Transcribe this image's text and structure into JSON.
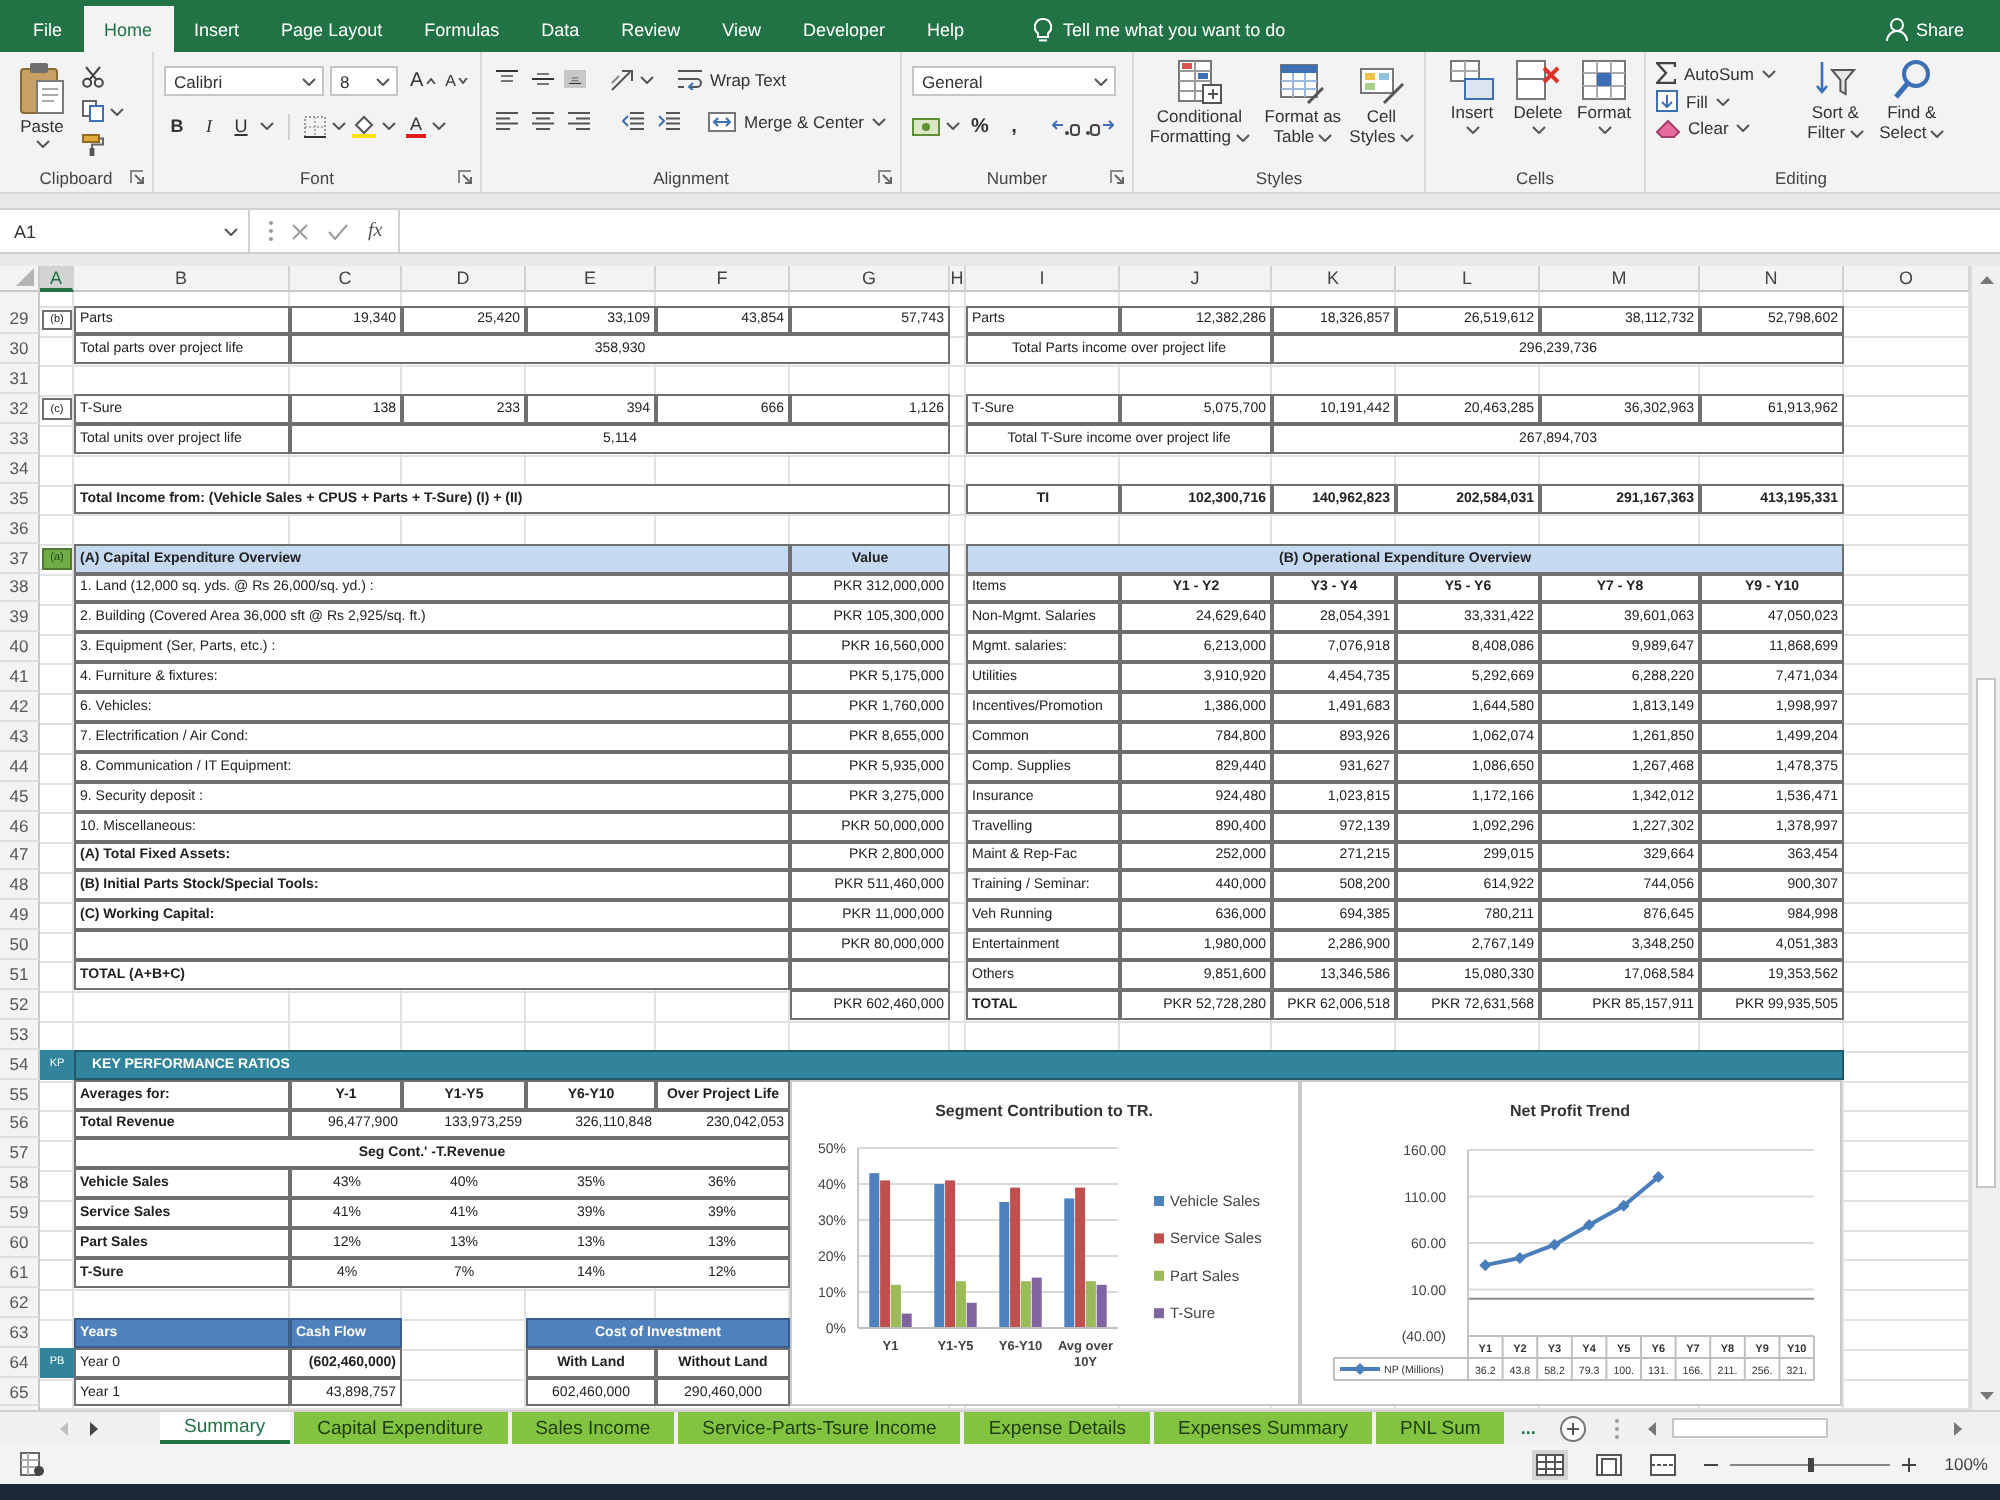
{
  "menu_tabs": [
    {
      "label": "File",
      "selected": false
    },
    {
      "label": "Home",
      "selected": true
    },
    {
      "label": "Insert",
      "selected": false
    },
    {
      "label": "Page Layout",
      "selected": false
    },
    {
      "label": "Formulas",
      "selected": false
    },
    {
      "label": "Data",
      "selected": false
    },
    {
      "label": "Review",
      "selected": false
    },
    {
      "label": "View",
      "selected": false
    },
    {
      "label": "Developer",
      "selected": false
    },
    {
      "label": "Help",
      "selected": false
    }
  ],
  "tell_me": "Tell me what you want to do",
  "share": "Share",
  "ribbon": {
    "clipboard": {
      "label": "Clipboard",
      "paste": "Paste"
    },
    "font": {
      "label": "Font",
      "font_name": "Calibri",
      "font_size": "8",
      "grow": "A",
      "shrink": "A",
      "bold": "B",
      "italic": "I",
      "underline": "U",
      "font_color": "A"
    },
    "alignment": {
      "label": "Alignment",
      "vertical_align": [
        {
          "selected": false
        },
        {
          "selected": false
        },
        {
          "selected": true
        }
      ],
      "wrap_text": "Wrap Text",
      "merge": "Merge & Center"
    },
    "number": {
      "label": "Number",
      "format": "General",
      "percent": "%",
      "comma": ","
    },
    "styles": {
      "label": "Styles",
      "buttons": [
        "Conditional Formatting",
        "Format as Table",
        "Cell Styles"
      ]
    },
    "cells": {
      "label": "Cells",
      "buttons": [
        "Insert",
        "Delete",
        "Format"
      ]
    },
    "editing": {
      "label": "Editing",
      "autosum": "AutoSum",
      "fill": "Fill",
      "clear": "Clear",
      "buttons": [
        "Sort & Filter",
        "Find & Select"
      ]
    }
  },
  "formula_bar": {
    "name_box": "A1",
    "function_label": "fx"
  },
  "sheet": {
    "columns": [
      {
        "label": "A",
        "selected": true
      },
      {
        "label": "B",
        "selected": false
      },
      {
        "label": "C",
        "selected": false
      },
      {
        "label": "D",
        "selected": false
      },
      {
        "label": "E",
        "selected": false
      },
      {
        "label": "F",
        "selected": false
      },
      {
        "label": "G",
        "selected": false
      },
      {
        "label": "H",
        "selected": false
      },
      {
        "label": "I",
        "selected": false
      },
      {
        "label": "J",
        "selected": false
      },
      {
        "label": "K",
        "selected": false
      },
      {
        "label": "L",
        "selected": false
      },
      {
        "label": "M",
        "selected": false
      },
      {
        "label": "N",
        "selected": false
      },
      {
        "label": "O",
        "selected": false
      }
    ],
    "rows": [
      {
        "number": "29",
        "kind": "units",
        "tag": "(b)",
        "label": "Parts",
        "values": [
          "19,340",
          "25,420",
          "33,109",
          "43,854",
          "57,743"
        ],
        "income_label": "Parts",
        "income": [
          "12,382,286",
          "18,326,857",
          "26,519,612",
          "38,112,732",
          "52,798,602"
        ]
      },
      {
        "number": "30",
        "kind": "unit_total",
        "label": "Total parts over project life",
        "value": "358,930",
        "income_label": "Total Parts income over project life",
        "income_value": "296,239,736"
      },
      {
        "number": "31",
        "kind": "blank"
      },
      {
        "number": "32",
        "kind": "units",
        "tag": "(c)",
        "label": "T-Sure",
        "values": [
          "138",
          "233",
          "394",
          "666",
          "1,126"
        ],
        "income_label": "T-Sure",
        "income": [
          "5,075,700",
          "10,191,442",
          "20,463,285",
          "36,302,963",
          "61,913,962"
        ]
      },
      {
        "number": "33",
        "kind": "unit_total",
        "label": "Total units over project life",
        "value": "5,114",
        "income_label": "Total T-Sure income over project life",
        "income_value": "267,894,703"
      },
      {
        "number": "34",
        "kind": "blank"
      },
      {
        "number": "35",
        "kind": "income_total",
        "label": "Total Income from: (Vehicle Sales + CPUS + Parts + T-Sure) (I) + (II)",
        "income_label": "TI",
        "income": [
          "102,300,716",
          "140,962,823",
          "202,584,031",
          "291,167,363",
          "413,195,331"
        ]
      },
      {
        "number": "36",
        "kind": "blank"
      },
      {
        "number": "37",
        "kind": "overview_header",
        "tag": "(a)",
        "capex_title": "(A) Capital Expenditure Overview",
        "value_title": "Value",
        "opex_title": "(B) Operational Expenditure Overview"
      },
      {
        "number": "38",
        "kind": "overview_columns",
        "capex_label": "1. Land (12,000 sq. yds. @ Rs 26,000/sq. yd.) :",
        "capex_value": "PKR 312,000,000",
        "opex_label": "Items",
        "opex_values": [
          "Y1 - Y2",
          "Y3 - Y4",
          "Y5 - Y6",
          "Y7 - Y8",
          "Y9 - Y10"
        ]
      },
      {
        "number": "39",
        "kind": "overview_item",
        "capex_label": "2. Building (Covered Area 36,000 sft @ Rs 2,925/sq. ft.)",
        "capex_value": "PKR 105,300,000",
        "opex_label": "Non-Mgmt. Salaries",
        "opex_values": [
          "24,629,640",
          "28,054,391",
          "33,331,422",
          "39,601,063",
          "47,050,023"
        ]
      },
      {
        "number": "40",
        "kind": "overview_item",
        "capex_label": "3. Equipment (Ser, Parts, etc.) :",
        "capex_value": "PKR 16,560,000",
        "opex_label": "Mgmt. salaries:",
        "opex_values": [
          "6,213,000",
          "7,076,918",
          "8,408,086",
          "9,989,647",
          "11,868,699"
        ]
      },
      {
        "number": "41",
        "kind": "overview_item",
        "capex_label": "4. Furniture & fixtures:",
        "capex_value": "PKR 5,175,000",
        "opex_label": "Utilities",
        "opex_values": [
          "3,910,920",
          "4,454,735",
          "5,292,669",
          "6,288,220",
          "7,471,034"
        ]
      },
      {
        "number": "42",
        "kind": "overview_item",
        "capex_label": "6. Vehicles:",
        "capex_value": "PKR 1,760,000",
        "opex_label": "Incentives/Promotion",
        "opex_values": [
          "1,386,000",
          "1,491,683",
          "1,644,580",
          "1,813,149",
          "1,998,997"
        ]
      },
      {
        "number": "43",
        "kind": "overview_item",
        "capex_label": "7. Electrification / Air Cond:",
        "capex_value": "PKR 8,655,000",
        "opex_label": "Common",
        "opex_values": [
          "784,800",
          "893,926",
          "1,062,074",
          "1,261,850",
          "1,499,204"
        ]
      },
      {
        "number": "44",
        "kind": "overview_item",
        "capex_label": "8. Communication / IT Equipment:",
        "capex_value": "PKR 5,935,000",
        "opex_label": "Comp. Supplies",
        "opex_values": [
          "829,440",
          "931,627",
          "1,086,650",
          "1,267,468",
          "1,478,375"
        ]
      },
      {
        "number": "45",
        "kind": "overview_item",
        "capex_label": "9. Security deposit :",
        "capex_value": "PKR 3,275,000",
        "opex_label": "Insurance",
        "opex_values": [
          "924,480",
          "1,023,815",
          "1,172,166",
          "1,342,012",
          "1,536,471"
        ]
      },
      {
        "number": "46",
        "kind": "overview_item",
        "capex_label": "10. Miscellaneous:",
        "capex_value": "PKR 50,000,000",
        "opex_label": "Travelling",
        "opex_values": [
          "890,400",
          "972,139",
          "1,092,296",
          "1,227,302",
          "1,378,997"
        ]
      },
      {
        "number": "47",
        "kind": "overview_bold",
        "capex_label": "(A) Total Fixed Assets:",
        "capex_value": "PKR 2,800,000",
        "opex_label": "Maint & Rep-Fac",
        "opex_values": [
          "252,000",
          "271,215",
          "299,015",
          "329,664",
          "363,454"
        ]
      },
      {
        "number": "48",
        "kind": "overview_bold",
        "capex_label": "(B) Initial Parts Stock/Special Tools:",
        "capex_value": "PKR 511,460,000",
        "opex_label": "Training / Seminar:",
        "opex_values": [
          "440,000",
          "508,200",
          "614,922",
          "744,056",
          "900,307"
        ]
      },
      {
        "number": "49",
        "kind": "overview_bold",
        "capex_label": "(C) Working Capital:",
        "capex_value": "PKR 11,000,000",
        "opex_label": "Veh Running",
        "opex_values": [
          "636,000",
          "694,385",
          "780,211",
          "876,645",
          "984,998"
        ]
      },
      {
        "number": "50",
        "kind": "overview_item",
        "capex_value": "PKR 80,000,000",
        "opex_label": "Entertainment",
        "opex_values": [
          "1,980,000",
          "2,286,900",
          "2,767,149",
          "3,348,250",
          "4,051,383"
        ]
      },
      {
        "number": "51",
        "kind": "overview_bold",
        "capex_label": "TOTAL (A+B+C)",
        "opex_label": "Others",
        "opex_values": [
          "9,851,600",
          "13,346,586",
          "15,080,330",
          "17,068,584",
          "19,353,562"
        ]
      },
      {
        "number": "52",
        "kind": "overview_total",
        "capex_value": "PKR 602,460,000",
        "opex_label": "TOTAL",
        "opex_values": [
          "PKR 52,728,280",
          "PKR 62,006,518",
          "PKR 72,631,568",
          "PKR 85,157,911",
          "PKR 99,935,505"
        ]
      },
      {
        "number": "53",
        "kind": "blank"
      },
      {
        "number": "54",
        "kind": "kpi_header",
        "tag": "KP",
        "label": "KEY PERFORMANCE RATIOS"
      },
      {
        "number": "55",
        "kind": "kpi_columns",
        "label": "Averages for:",
        "values": [
          "Y-1",
          "Y1-Y5",
          "Y6-Y10",
          "Over Project Life"
        ]
      },
      {
        "number": "56",
        "kind": "kpi_values",
        "label": "Total Revenue",
        "values": [
          "96,477,900",
          "133,973,259",
          "326,110,848",
          "230,042,053"
        ]
      },
      {
        "number": "57",
        "kind": "kpi_subheader",
        "label": "Seg Cont.' -T.Revenue"
      },
      {
        "number": "58",
        "kind": "kpi_share",
        "label": "Vehicle Sales",
        "values": [
          "43%",
          "40%",
          "35%",
          "36%"
        ]
      },
      {
        "number": "59",
        "kind": "kpi_share",
        "label": "Service Sales",
        "values": [
          "41%",
          "41%",
          "39%",
          "39%"
        ]
      },
      {
        "number": "60",
        "kind": "kpi_share",
        "label": "Part Sales",
        "values": [
          "12%",
          "13%",
          "13%",
          "13%"
        ]
      },
      {
        "number": "61",
        "kind": "kpi_share",
        "label": "T-Sure",
        "values": [
          "4%",
          "7%",
          "14%",
          "12%"
        ]
      },
      {
        "number": "62",
        "kind": "blank"
      },
      {
        "number": "63",
        "kind": "cash_header",
        "label": "Years",
        "value": "Cash Flow",
        "cost_label": "Cost of Investment"
      },
      {
        "number": "64",
        "kind": "cash_row_bold",
        "tag": "PB",
        "label": "Year 0",
        "value": "(602,460,000)",
        "cost_values": [
          "With Land",
          "Without Land"
        ]
      },
      {
        "number": "65",
        "kind": "cash_row",
        "label": "Year 1",
        "value": "43,898,757",
        "cost_values": [
          "602,460,000",
          "290,460,000"
        ]
      }
    ],
    "charts": [
      {
        "chart_data": {
          "type": "bar",
          "title": "Segment Contribution to TR.",
          "categories": [
            "Y1",
            "Y1-Y5",
            "Y6-Y10",
            "Avg over 10Y"
          ],
          "series": [
            {
              "name": "Vehicle Sales",
              "color": "#4f81bd",
              "values": [
                43,
                40,
                35,
                36
              ]
            },
            {
              "name": "Service Sales",
              "color": "#c0504d",
              "values": [
                41,
                41,
                39,
                39
              ]
            },
            {
              "name": "Part Sales",
              "color": "#9bbb59",
              "values": [
                12,
                13,
                13,
                13
              ]
            },
            {
              "name": "T-Sure",
              "color": "#8064a2",
              "values": [
                4,
                7,
                14,
                12
              ]
            }
          ],
          "ylim": [
            0,
            50
          ],
          "yticks": [
            {
              "value": 0,
              "label": "0%"
            },
            {
              "value": 10,
              "label": "10%"
            },
            {
              "value": 20,
              "label": "20%"
            },
            {
              "value": 30,
              "label": "30%"
            },
            {
              "value": 40,
              "label": "40%"
            },
            {
              "value": 50,
              "label": "50%"
            }
          ],
          "legend": "right",
          "grid": true
        }
      },
      {
        "chart_data": {
          "type": "line",
          "title": "Net Profit Trend",
          "categories": [
            "Y1",
            "Y2",
            "Y3",
            "Y4",
            "Y5",
            "Y6",
            "Y7",
            "Y8",
            "Y9",
            "Y10"
          ],
          "series": [
            {
              "name": "NP (Millions)",
              "color": "#4a7ebb",
              "values": [
                36.2,
                43.8,
                58.2,
                79.3,
                100,
                131,
                null,
                null,
                null,
                null
              ]
            }
          ],
          "ylim": [
            -40,
            160
          ],
          "yticks": [
            {
              "value": -40,
              "label": "(40.00)"
            },
            {
              "value": 10,
              "label": "10.00"
            },
            {
              "value": 60,
              "label": "60.00"
            },
            {
              "value": 110,
              "label": "110.00"
            },
            {
              "value": 160,
              "label": "160.00"
            }
          ],
          "marker": "diamond",
          "grid": true
        },
        "data_table": [
          "36.2",
          "43.8",
          "58.2",
          "79.3",
          "100.",
          "131.",
          "166.",
          "211.",
          "256.",
          "321."
        ]
      }
    ]
  },
  "sheet_tabs": {
    "tabs": [
      {
        "label": "Summary",
        "selected": true
      },
      {
        "label": "Capital Expenditure",
        "selected": false
      },
      {
        "label": "Sales Income",
        "selected": false
      },
      {
        "label": "Service-Parts-Tsure Income",
        "selected": false
      },
      {
        "label": "Expense Details",
        "selected": false
      },
      {
        "label": "Expenses Summary",
        "selected": false
      },
      {
        "label": "PNL Sum",
        "selected": false
      }
    ],
    "more": "..."
  },
  "status_bar": {
    "views": [
      {
        "selected": true
      },
      {
        "selected": false
      },
      {
        "selected": false
      }
    ],
    "zoom_slider": {
      "level": 0.5
    },
    "zoom": "100%"
  }
}
